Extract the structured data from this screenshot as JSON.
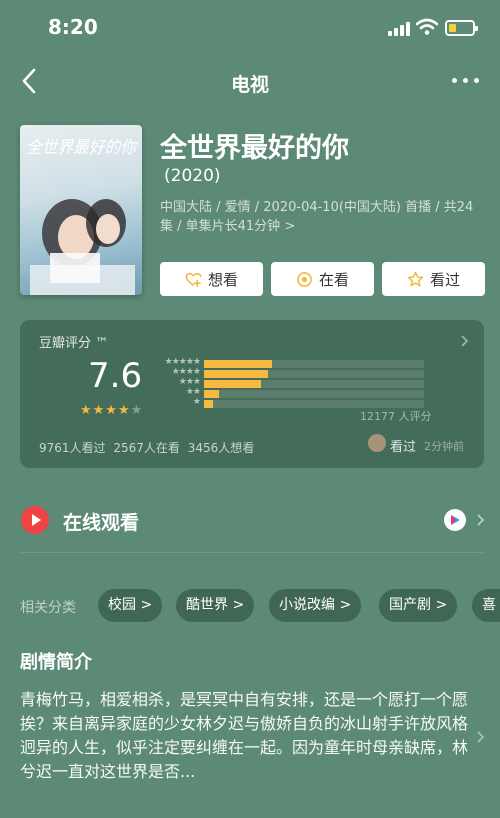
{
  "status": {
    "time": "8:20"
  },
  "nav": {
    "title": "电视"
  },
  "show": {
    "poster_text": "全世界最好的你",
    "title": "全世界最好的你",
    "year": "(2020)",
    "meta": "中国大陆 / 爱情 / 2020-04-10(中国大陆) 首播 / 共24集 / 单集片长41分钟 >"
  },
  "actions": [
    {
      "label": "想看",
      "icon": "heart-plus-icon"
    },
    {
      "label": "在看",
      "icon": "target-icon"
    },
    {
      "label": "看过",
      "icon": "star-outline-icon"
    }
  ],
  "rating": {
    "title": "豆瓣评分 ™",
    "score": "7.6",
    "stars_display": "★★★★",
    "star_count": 4,
    "distribution": [
      {
        "label": "★★★★★",
        "fraction": 0.31
      },
      {
        "label": "★★★★",
        "fraction": 0.29
      },
      {
        "label": "★★★",
        "fraction": 0.26
      },
      {
        "label": "★★",
        "fraction": 0.07
      },
      {
        "label": "★",
        "fraction": 0.04
      }
    ],
    "count": "12177 人评分",
    "footer": "9761人看过   2567人在看   3456人想看",
    "watched_label": "看过",
    "watched_time": "2分钟前"
  },
  "online": {
    "label": "在线观看",
    "platform_icon": "youku-logo-icon"
  },
  "tags": {
    "label": "相关分类",
    "items": [
      "校园 >",
      "酷世界 >",
      "小说改编 >",
      "国产剧 >",
      "喜"
    ]
  },
  "synopsis": {
    "heading": "剧情简介",
    "text": "青梅竹马，相爱相杀，是冥冥中自有安排，还是一个愿打一个愿挨？来自离异家庭的少女林夕迟与傲娇自负的冰山射手许放风格迥异的人生，似乎注定要纠缠在一起。因为童年时母亲缺席，林兮迟一直对这世界是否..."
  },
  "colors": {
    "background": "#5c8a76",
    "accent_bar": "#f7b93e",
    "play_red": "#f04343"
  }
}
